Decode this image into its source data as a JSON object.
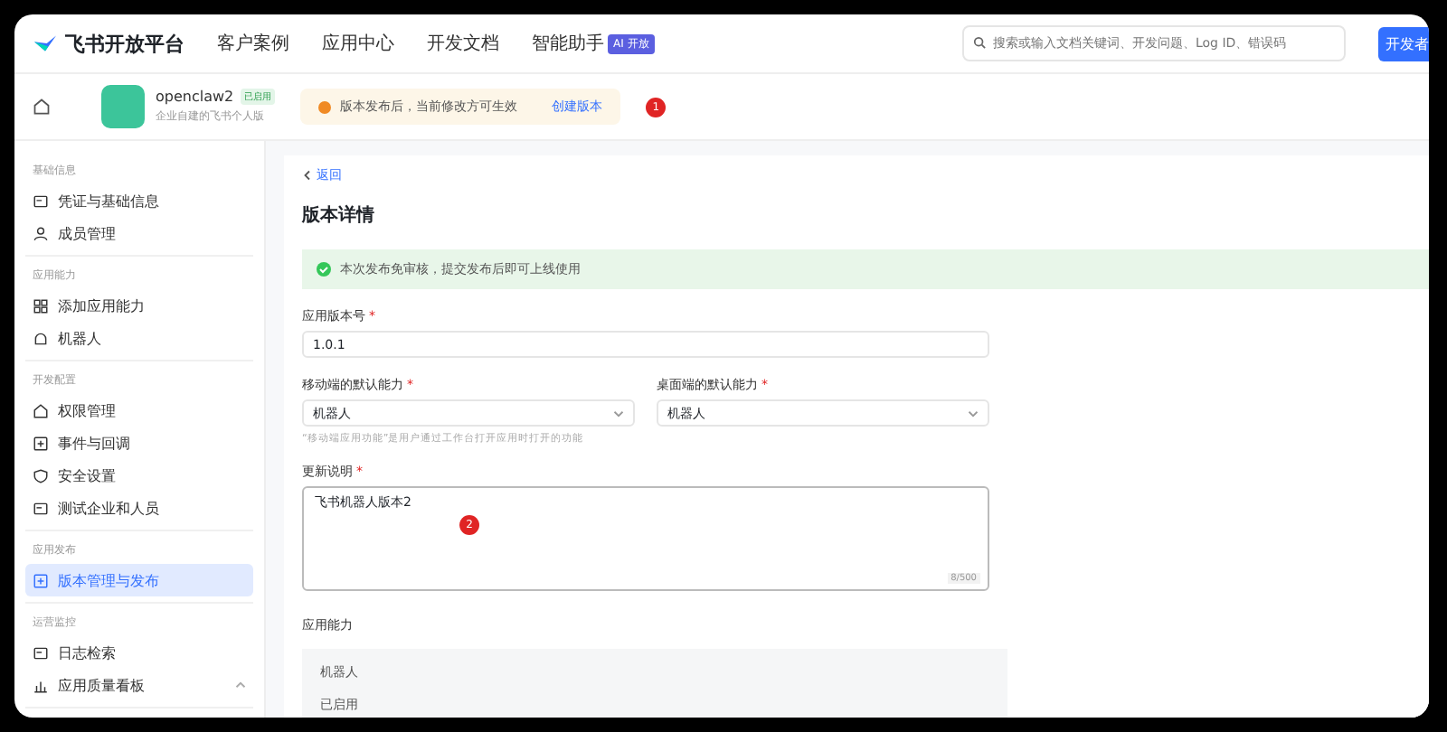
{
  "header": {
    "logo": "飞书开放平台",
    "nav": [
      "客户案例",
      "应用中心",
      "开发文档",
      "智能助手"
    ],
    "nav_badge": "AI 开放",
    "search": {
      "placeholder": "搜索或输入文档关键词、开发问题、Log ID、错误码"
    },
    "button": "开发者"
  },
  "app_bar": {
    "app_name": "openclaw2",
    "app_tag": "已启用",
    "app_desc": "企业自建的飞书个人版",
    "notice": "版本发布后，当前修改方可生效",
    "notice_link": "创建版本",
    "marker": "1"
  },
  "sidebar": {
    "groups": [
      {
        "title": "基础信息",
        "items": [
          {
            "label": "凭证与基础信息",
            "selected": false
          },
          {
            "label": "成员管理",
            "selected": false
          }
        ]
      },
      {
        "title": "应用能力",
        "items": [
          {
            "label": "添加应用能力",
            "selected": false
          },
          {
            "label": "机器人",
            "selected": false
          }
        ]
      },
      {
        "title": "开发配置",
        "items": [
          {
            "label": "权限管理",
            "selected": false
          },
          {
            "label": "事件与回调",
            "selected": false
          },
          {
            "label": "安全设置",
            "selected": false
          },
          {
            "label": "测试企业和人员",
            "selected": false
          }
        ]
      },
      {
        "title": "应用发布",
        "items": [
          {
            "label": "版本管理与发布",
            "selected": true
          }
        ]
      },
      {
        "title": "运营监控",
        "items": [
          {
            "label": "日志检索",
            "selected": false
          },
          {
            "label": "应用质量看板",
            "selected": false,
            "expandable": true
          }
        ]
      }
    ]
  },
  "main": {
    "back": "返回",
    "title": "版本详情",
    "alert": "本次发布免审核，提交发布后即可上线使用",
    "version": {
      "label": "应用版本号",
      "required_mark": "*",
      "value": "1.0.1"
    },
    "mobile": {
      "label": "移动端的默认能力",
      "required_mark": "*",
      "value": "机器人"
    },
    "desktop": {
      "label": "桌面端的默认能力",
      "required_mark": "*",
      "value": "机器人"
    },
    "hint": "“移动端应用功能”是用户通过工作台打开应用时打开的功能",
    "notes": {
      "label": "更新说明",
      "required_mark": "*",
      "value": "飞书机器人版本2",
      "counter": "8/500",
      "marker": "2"
    },
    "abilities": {
      "label": "应用能力",
      "items": [
        "机器人",
        "已启用"
      ]
    }
  }
}
